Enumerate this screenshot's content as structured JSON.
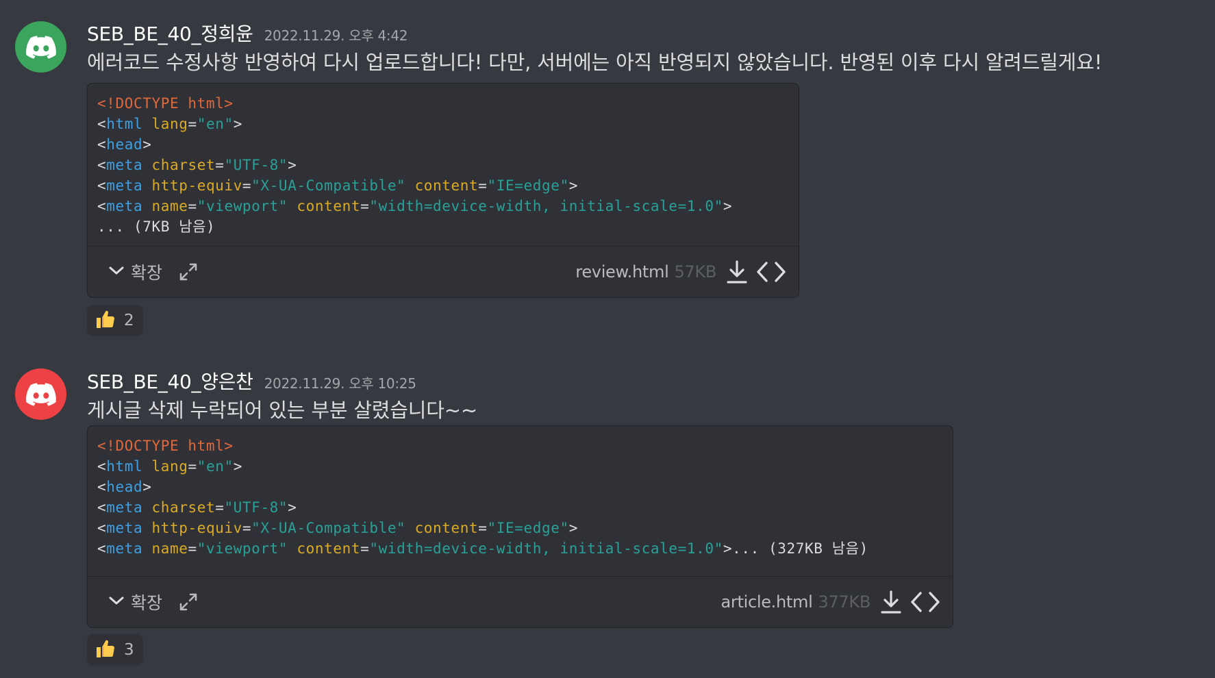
{
  "messages": [
    {
      "avatar_color": "#3ba55d",
      "username": "SEB_BE_40_정희윤",
      "timestamp": "2022.11.29. 오후 4:42",
      "content": "에러코드 수정사항 반영하여 다시 업로드합니다! 다만, 서버에는 아직 반영되지 않았습니다. 반영된 이후 다시 알려드릴게요!",
      "attachment": {
        "preview_lines": [
          "<!DOCTYPE html>",
          "<html lang=\"en\">",
          "<head>",
          "<meta charset=\"UTF-8\">",
          "<meta http-equiv=\"X-UA-Compatible\" content=\"IE=edge\">",
          "<meta name=\"viewport\" content=\"width=device-width, initial-scale=1.0\">",
          "... (7KB 남음)"
        ],
        "expand_label": "확장",
        "filename": "review.html",
        "filesize": "57KB"
      },
      "reaction": {
        "emoji": "thumbs-up",
        "count": "2"
      }
    },
    {
      "avatar_color": "#ed4245",
      "username": "SEB_BE_40_양은찬",
      "timestamp": "2022.11.29. 오후 10:25",
      "content": "게시글 삭제 누락되어 있는 부분 살렸습니다~~",
      "attachment": {
        "preview_lines": [
          "<!DOCTYPE html>",
          "<html lang=\"en\">",
          "<head>",
          "<meta charset=\"UTF-8\">",
          "<meta http-equiv=\"X-UA-Compatible\" content=\"IE=edge\">",
          "<meta name=\"viewport\" content=\"width=device-width, initial-scale=1.0\">... (327KB 남음)"
        ],
        "expand_label": "확장",
        "filename": "article.html",
        "filesize": "377KB"
      },
      "reaction": {
        "emoji": "thumbs-up",
        "count": "3"
      }
    }
  ],
  "colors": {
    "background": "#36393f",
    "code_background": "#2f3136",
    "doctype": "#e2683c",
    "tag": "#3ea0e4",
    "attribute": "#dcab24",
    "string": "#2aa198"
  }
}
